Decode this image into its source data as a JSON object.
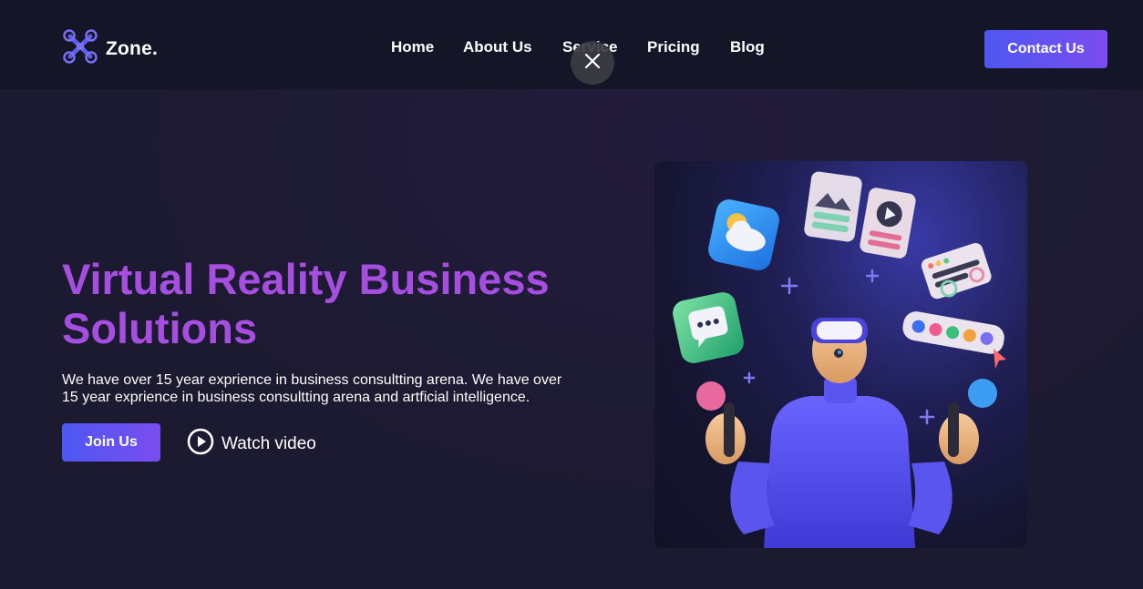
{
  "brand": {
    "name": "Zone.",
    "icon": "drone-icon"
  },
  "nav": {
    "links": [
      "Home",
      "About Us",
      "Service",
      "Pricing",
      "Blog"
    ],
    "contact_label": "Contact Us"
  },
  "overlay": {
    "close_icon": "close-icon"
  },
  "hero": {
    "title": "Virtual Reality Business Solutions",
    "description": "We have over 15 year exprience in business consultting arena. We have over 15 year exprience in business consultting arena and artficial intelligence.",
    "join_label": "Join Us",
    "watch_label": "Watch video",
    "watch_icon": "play-circle-icon",
    "image": "vr-user-illustration"
  },
  "colors": {
    "accent": "#5b55f0",
    "title": "#a54ee0",
    "nav_bg": "#141628",
    "page_bg": "#1c1a30"
  }
}
